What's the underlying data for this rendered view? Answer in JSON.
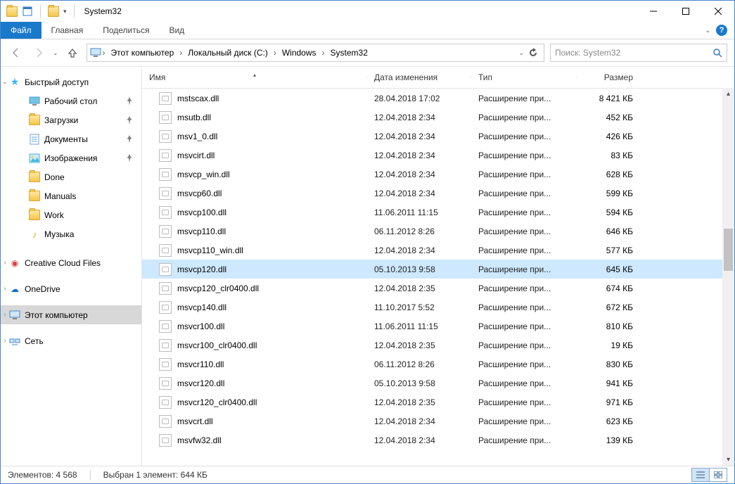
{
  "window": {
    "title": "System32"
  },
  "ribbon": {
    "file": "Файл",
    "tabs": [
      "Главная",
      "Поделиться",
      "Вид"
    ]
  },
  "breadcrumb": {
    "items": [
      "Этот компьютер",
      "Локальный диск (C:)",
      "Windows",
      "System32"
    ]
  },
  "search": {
    "placeholder": "Поиск: System32"
  },
  "sidebar": {
    "quick_access": "Быстрый доступ",
    "quick_items": [
      {
        "label": "Рабочий стол",
        "pinned": true,
        "icon": "desktop"
      },
      {
        "label": "Загрузки",
        "pinned": true,
        "icon": "folder"
      },
      {
        "label": "Документы",
        "pinned": true,
        "icon": "doc"
      },
      {
        "label": "Изображения",
        "pinned": true,
        "icon": "pic"
      },
      {
        "label": "Done",
        "pinned": false,
        "icon": "folder"
      },
      {
        "label": "Manuals",
        "pinned": false,
        "icon": "folder"
      },
      {
        "label": "Work",
        "pinned": false,
        "icon": "folder"
      },
      {
        "label": "Музыка",
        "pinned": false,
        "icon": "music"
      }
    ],
    "creative_cloud": "Creative Cloud Files",
    "onedrive": "OneDrive",
    "this_pc": "Этот компьютер",
    "network": "Сеть"
  },
  "columns": {
    "name": "Имя",
    "date": "Дата изменения",
    "type": "Тип",
    "size": "Размер"
  },
  "files": [
    {
      "name": "mstscax.dll",
      "date": "28.04.2018 17:02",
      "type": "Расширение при...",
      "size": "8 421 КБ"
    },
    {
      "name": "msutb.dll",
      "date": "12.04.2018 2:34",
      "type": "Расширение при...",
      "size": "452 КБ"
    },
    {
      "name": "msv1_0.dll",
      "date": "12.04.2018 2:34",
      "type": "Расширение при...",
      "size": "426 КБ"
    },
    {
      "name": "msvcirt.dll",
      "date": "12.04.2018 2:34",
      "type": "Расширение при...",
      "size": "83 КБ"
    },
    {
      "name": "msvcp_win.dll",
      "date": "12.04.2018 2:34",
      "type": "Расширение при...",
      "size": "628 КБ"
    },
    {
      "name": "msvcp60.dll",
      "date": "12.04.2018 2:34",
      "type": "Расширение при...",
      "size": "599 КБ"
    },
    {
      "name": "msvcp100.dll",
      "date": "11.06.2011 11:15",
      "type": "Расширение при...",
      "size": "594 КБ"
    },
    {
      "name": "msvcp110.dll",
      "date": "06.11.2012 8:26",
      "type": "Расширение при...",
      "size": "646 КБ"
    },
    {
      "name": "msvcp110_win.dll",
      "date": "12.04.2018 2:34",
      "type": "Расширение при...",
      "size": "577 КБ"
    },
    {
      "name": "msvcp120.dll",
      "date": "05.10.2013 9:58",
      "type": "Расширение при...",
      "size": "645 КБ",
      "selected": true
    },
    {
      "name": "msvcp120_clr0400.dll",
      "date": "12.04.2018 2:35",
      "type": "Расширение при...",
      "size": "674 КБ"
    },
    {
      "name": "msvcp140.dll",
      "date": "11.10.2017 5:52",
      "type": "Расширение при...",
      "size": "672 КБ"
    },
    {
      "name": "msvcr100.dll",
      "date": "11.06.2011 11:15",
      "type": "Расширение при...",
      "size": "810 КБ"
    },
    {
      "name": "msvcr100_clr0400.dll",
      "date": "12.04.2018 2:35",
      "type": "Расширение при...",
      "size": "19 КБ"
    },
    {
      "name": "msvcr110.dll",
      "date": "06.11.2012 8:26",
      "type": "Расширение при...",
      "size": "830 КБ"
    },
    {
      "name": "msvcr120.dll",
      "date": "05.10.2013 9:58",
      "type": "Расширение при...",
      "size": "941 КБ"
    },
    {
      "name": "msvcr120_clr0400.dll",
      "date": "12.04.2018 2:35",
      "type": "Расширение при...",
      "size": "971 КБ"
    },
    {
      "name": "msvcrt.dll",
      "date": "12.04.2018 2:34",
      "type": "Расширение при...",
      "size": "623 КБ"
    },
    {
      "name": "msvfw32.dll",
      "date": "12.04.2018 2:34",
      "type": "Расширение при...",
      "size": "139 КБ"
    }
  ],
  "status": {
    "count_label": "Элементов:",
    "count": "4 568",
    "selection": "Выбран 1 элемент: 644 КБ"
  }
}
